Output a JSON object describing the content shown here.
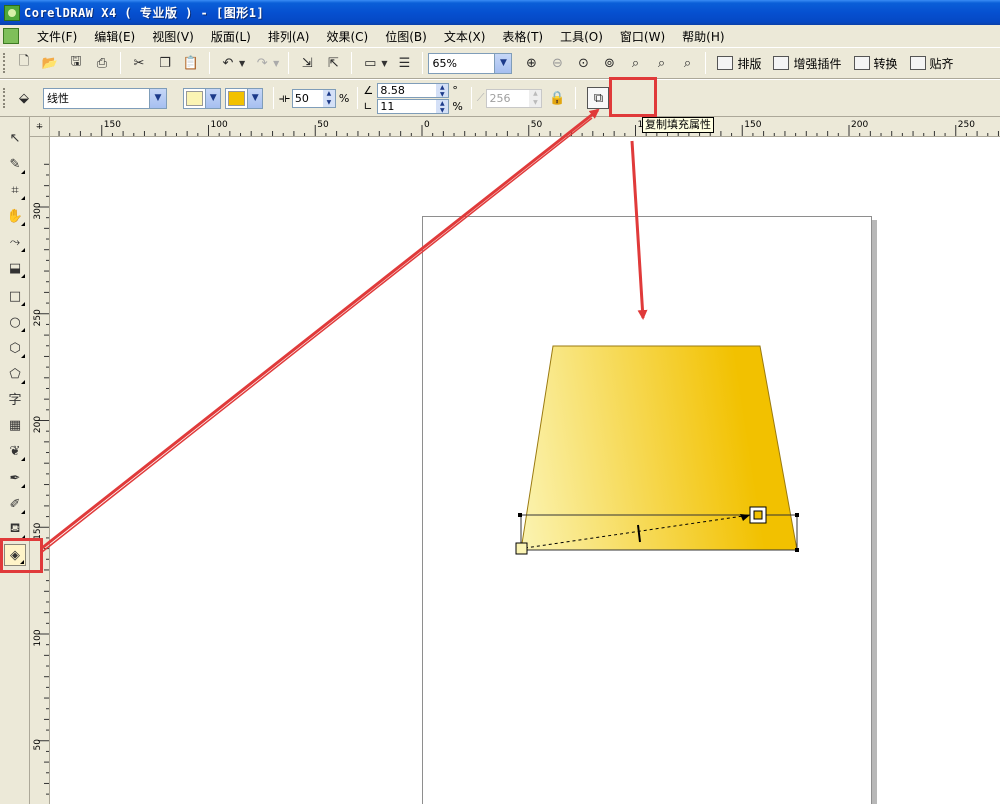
{
  "window": {
    "title": "CorelDRAW X4 ( 专业版 ) - [图形1]"
  },
  "menu": [
    "文件(F)",
    "编辑(E)",
    "视图(V)",
    "版面(L)",
    "排列(A)",
    "效果(C)",
    "位图(B)",
    "文本(X)",
    "表格(T)",
    "工具(O)",
    "窗口(W)",
    "帮助(H)"
  ],
  "toolbar": {
    "zoom": "65%",
    "buttons": {
      "layout": "排版",
      "plugins": "增强插件",
      "convert": "转换",
      "snap": "贴齐"
    }
  },
  "property_bar": {
    "fill_type": "线性",
    "color_from": "#fbf4b4",
    "color_to": "#f2c100",
    "midpoint": "50",
    "midpoint_unit": "%",
    "angle": "8.58",
    "angle_unit": "°",
    "edge_pad": "11",
    "edge_pad_unit": "%",
    "steps": "256",
    "copy_fill_tooltip": "复制填充属性"
  },
  "ruler": {
    "horizontal_ticks": [
      "150",
      "100",
      "50",
      "0",
      "50",
      "100",
      "150",
      "200",
      "250"
    ],
    "vertical_ticks": [
      "300",
      "250",
      "200",
      "150",
      "100",
      "50"
    ]
  },
  "colors": {
    "gradient_start": "#fbf4b4",
    "gradient_end": "#f2c100",
    "annotation": "#e03a3a"
  },
  "toolbox_icons": [
    "pick-icon",
    "shape-icon",
    "crop-icon",
    "zoom-pan-icon",
    "freehand-icon",
    "smart-fill-icon",
    "rectangle-icon",
    "ellipse-icon",
    "polygon-icon",
    "basic-shapes-icon",
    "text-icon",
    "table-icon",
    "blend-icon",
    "eyedropper-icon",
    "outline-pen-icon",
    "fill-icon",
    "interactive-fill-icon"
  ]
}
